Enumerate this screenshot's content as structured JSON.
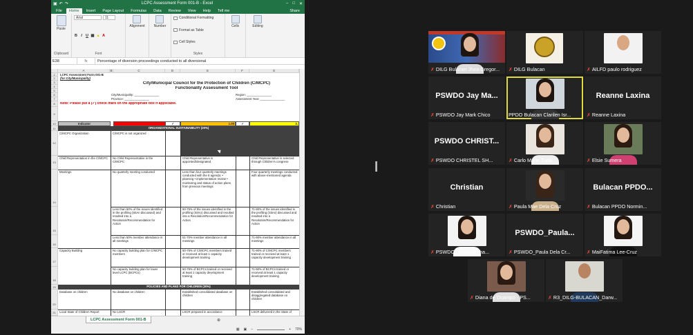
{
  "excel": {
    "window_title": "LCPC Assessment Form 001-B  -  Excel",
    "ribbon_tabs": [
      "File",
      "Home",
      "Insert",
      "Page Layout",
      "Formulas",
      "Data",
      "Review",
      "View",
      "Help",
      "Tell me",
      "Share"
    ],
    "active_tab": "Home",
    "ribbon": {
      "paste": "Paste",
      "clipboard": "Clipboard",
      "font_name": "Arial",
      "font_size": "11",
      "font_group": "Font",
      "alignment": "Alignment",
      "number": "Number",
      "conditional_formatting": "Conditional Formatting",
      "format_as_table": "Format as Table",
      "cell_styles": "Cell Styles",
      "styles_group": "Styles",
      "cells": "Cells",
      "editing": "Editing"
    },
    "name_box": "E38",
    "fx": "fx",
    "formula": "Percentage of diversion proceedings conducted to all diversional",
    "columns": [
      "A",
      "B",
      "C",
      "D",
      "E",
      "F",
      "G"
    ],
    "rows": [
      "1",
      "2",
      "3",
      "4",
      "5",
      "6",
      "7",
      "8",
      "9",
      "10",
      "11",
      "12",
      "13",
      "14",
      "15",
      "16",
      "17",
      "18",
      "19",
      "20",
      "21"
    ],
    "sheet": {
      "form_title": "LCPC Assessment Form 001-B",
      "for_city": "(for City/Municipality)",
      "main_title": "City/Municipal Council for the Protection of Children (C/MCPC)",
      "sub_title": "Functionality Assessment Tool",
      "city_label": "City/Municipality: _______________",
      "region_label": "Region: _______________",
      "province_label": "Province: _______________",
      "year_label": "Assessment Year: _______________",
      "note": "Note: Please put a (✓) check mark on the appropriate box if applicable.",
      "indicator": "Indicator",
      "check": "✓",
      "score_1": "1.00",
      "score_3": "3.",
      "section_1": "ORGANIZATIONAL SUSTAINABILITY (20%)",
      "section_2": "POLICIES AND PLANS FOR CHILDREN (30%)",
      "a12": "C/MCPC Organization",
      "c12": "C/MCPC is not organized",
      "a13": "Child Representation in the C/MCPC",
      "c13": "No Child Representative in the C/MCPC",
      "e13": "Child Representative is appointed/designated",
      "g13": "Child Representative is selected through Children's congress",
      "a14": "Meetings",
      "c14": "No quarterly meeting conducted",
      "e14": "Less than four quarterly meetings conducted with the 8 agenda: • planning • implementation review • monitoring and status of action plans from previous meetings",
      "g14": "Four quarterly meetings conducted with above-mentioned agenda",
      "c15": "Less than 50% of the issues identified in the profiling (SitAn discussed) and resulted into a Resolution/Recommendation for Action",
      "e15": "50-75% of the issues identified in the profiling (SitAn) discussed and resulted into a Resolution/Recommendation for Action",
      "g15": "71-90% of the issues identified in the profiling (SitAn) discussed and resulted into a Resolution/Recommendation for Action",
      "c16": "Less than 50% member attendance in all meetings",
      "e16": "51-70% member attendance in all meetings",
      "g16": "71-90% member attendance in all meetings",
      "a17": "Capacity Building",
      "c17": "No capacity building plan for C/MCPC members",
      "e17": "50-75% of C/MCPC members trained or received at least 1 capacity development training",
      "g17": "71-90% of C/MCPC members trained or received at least 1 capacity development training",
      "c18": "No capacity building plan for lower level LCPC (BCPCs)",
      "e18": "50-75% of BCPCs trained or received at least 1 capacity development training",
      "g18": "71-90% of BCPCs trained or received at least 1 capacity development training",
      "a20": "Database on children",
      "c20": "No database on children",
      "e20": "Established consolidated database on children",
      "g20": "Established consolidated and disaggregated database on children",
      "a21": "Local State of Children Report",
      "c21": "No LSCR",
      "e21": "LSCR prepared in accordance",
      "g21": "LSCR delivered in the State of"
    },
    "sheet_tab": "LCPC Assessment Form 001-B",
    "zoom": "70%"
  },
  "participants": [
    {
      "name": "DILG Bulacan Jhea Gregor...",
      "big": ""
    },
    {
      "name": "DILG Bulacan",
      "big": ""
    },
    {
      "name": "AILFD paulo rodriguez",
      "big": ""
    },
    {
      "name": "PSWDO Jay Mark Chico",
      "big": "PSWDO Jay Ma..."
    },
    {
      "name": "PPDO Bulacan Clarilen Isr...",
      "big": ""
    },
    {
      "name": "Reanne Laxina",
      "big": "Reanne Laxina"
    },
    {
      "name": "PSWDO CHRISTEL SH...",
      "big": "PSWDO CHRIST..."
    },
    {
      "name": "Carlo Marie Turla",
      "big": ""
    },
    {
      "name": "Elsie Sumera",
      "big": ""
    },
    {
      "name": "Christian",
      "big": "Christian"
    },
    {
      "name": "Paula Mae Dela Cruz",
      "big": ""
    },
    {
      "name": "Bulacan PPDO Normin...",
      "big": "Bulacan PPDO..."
    },
    {
      "name": "PSWDO - Anna Micha...",
      "big": ""
    },
    {
      "name": "PSWDO_Paula Dela Cr...",
      "big": "PSWDO_Paula..."
    },
    {
      "name": "MaiFatima Lee-Cruz",
      "big": ""
    },
    {
      "name": "Diana de Ocampo - PS...",
      "big": ""
    },
    {
      "name": "R3_DILG-BULACAN_Darw...",
      "big": ""
    }
  ],
  "colors": {
    "excel_green": "#217346",
    "active_speaker": "#e0dd3a",
    "muted": "#e74c3c"
  }
}
